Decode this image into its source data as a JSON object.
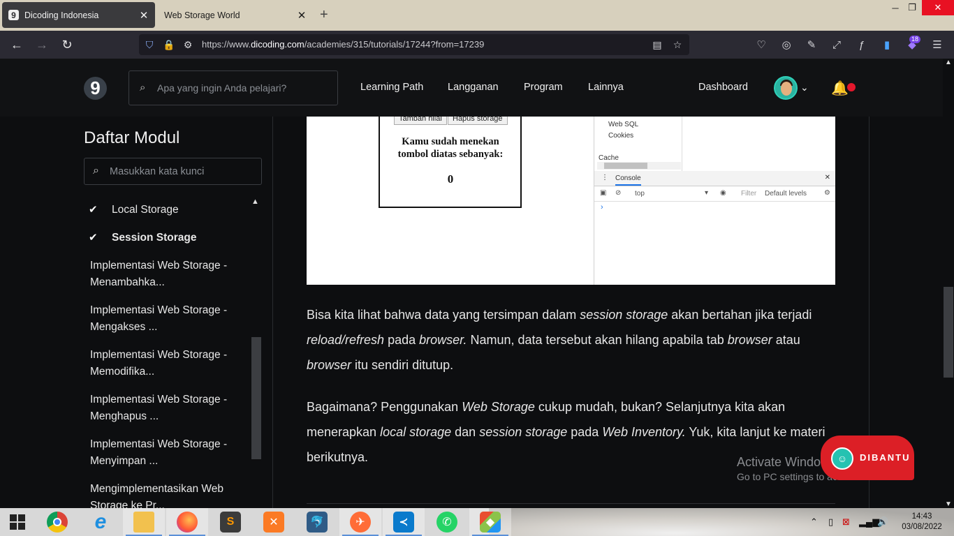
{
  "browser": {
    "tabs": [
      {
        "title": "Dicoding Indonesia",
        "favicon": "9"
      },
      {
        "title": "Web Storage World"
      }
    ],
    "url_prefix": "https://www.",
    "url_domain": "dicoding.com",
    "url_path": "/academies/315/tutorials/17244?from=17239",
    "extension_badge": "18",
    "colors": {
      "tabstrip": "#d7d0bd",
      "toolbar": "#2b2a33",
      "close": "#e81123"
    }
  },
  "site": {
    "logo": "9",
    "search_placeholder": "Apa yang ingin Anda pelajari?",
    "menu": [
      "Learning Path",
      "Langganan",
      "Program",
      "Lainnya"
    ],
    "dashboard": "Dashboard"
  },
  "sidebar": {
    "title": "Daftar Modul",
    "search_placeholder": "Masukkan kata kunci",
    "modules": [
      {
        "label": "Local Storage",
        "done": true
      },
      {
        "label": "Session Storage",
        "done": true,
        "current": true
      },
      {
        "label": "Implementasi Web Storage - Menambahka..."
      },
      {
        "label": "Implementasi Web Storage - Mengakses ..."
      },
      {
        "label": "Implementasi Web Storage - Memodifika..."
      },
      {
        "label": "Implementasi Web Storage - Menghapus ..."
      },
      {
        "label": "Implementasi Web Storage - Menyimpan ..."
      },
      {
        "label": "Mengimplementasikan Web Storage ke Pr..."
      }
    ]
  },
  "content": {
    "screenshot": {
      "btn_add": "Tambah nilai",
      "btn_clear": "Hapus storage",
      "text": "Kamu sudah menekan tombol diatas sebanyak:",
      "count": "0",
      "devtools": {
        "tree": [
          "Web SQL",
          "Cookies",
          "Cache"
        ],
        "tab": "Console",
        "context": "top",
        "filter": "Filter",
        "levels": "Default levels"
      }
    },
    "paragraph1": {
      "a": "Bisa kita lihat bahwa data yang tersimpan dalam ",
      "b": "session storage",
      "c": " akan bertahan jika terjadi ",
      "d": "reload/refresh",
      "e": " pada ",
      "f": "browser.",
      "g": " Namun, data tersebut akan hilang apabila tab ",
      "h": "browser",
      "i": " atau ",
      "j": "browser",
      "k": " itu sendiri ditutup."
    },
    "paragraph2": {
      "a": "Bagaimana? Penggunakan ",
      "b": "Web Storage",
      "c": " cukup mudah, bukan? Selanjutnya kita akan menerapkan ",
      "d": "local storage",
      "e": " dan ",
      "f": "session storage",
      "g": " pada ",
      "h": "Web Inventory.",
      "i": " Yuk, kita lanjut ke materi berikutnya."
    }
  },
  "overlay": {
    "activate_title": "Activate Windows",
    "activate_sub": "Go to PC settings to activate Windows.",
    "help_button": "DIBANTU"
  },
  "taskbar": {
    "apps": [
      "start",
      "chrome",
      "internet-explorer",
      "file-explorer",
      "firefox",
      "sublime-text",
      "xampp",
      "mysql-workbench",
      "postman",
      "vscode",
      "whatsapp",
      "git-gui"
    ],
    "time": "14:43",
    "date": "03/08/2022"
  }
}
